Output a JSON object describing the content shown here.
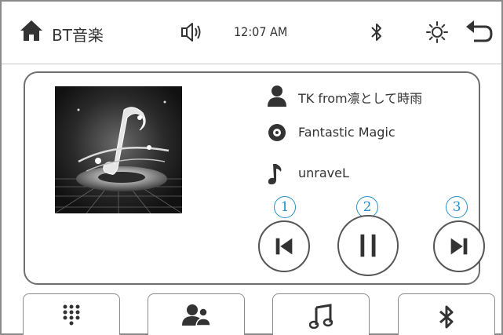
{
  "header": {
    "title": "BT音楽",
    "time": "12:07 AM",
    "icons": [
      "home-icon",
      "volume-icon",
      "bluetooth-icon",
      "brightness-icon",
      "back-icon"
    ]
  },
  "now_playing": {
    "artist": "TK from凛として時雨",
    "album": "Fantastic Magic",
    "track": "unraveL",
    "album_art": "music-note-album-art"
  },
  "controls": {
    "callouts": [
      "1",
      "2",
      "3"
    ],
    "prev": "previous-track",
    "playpause": "pause",
    "next": "next-track"
  },
  "bottom_nav": {
    "items": [
      "keypad-icon",
      "contacts-icon",
      "music-icon",
      "bluetooth-icon"
    ]
  },
  "colors": {
    "icon": "#333333",
    "callout": "#2a8fc9",
    "border": "#6f6f6f"
  }
}
